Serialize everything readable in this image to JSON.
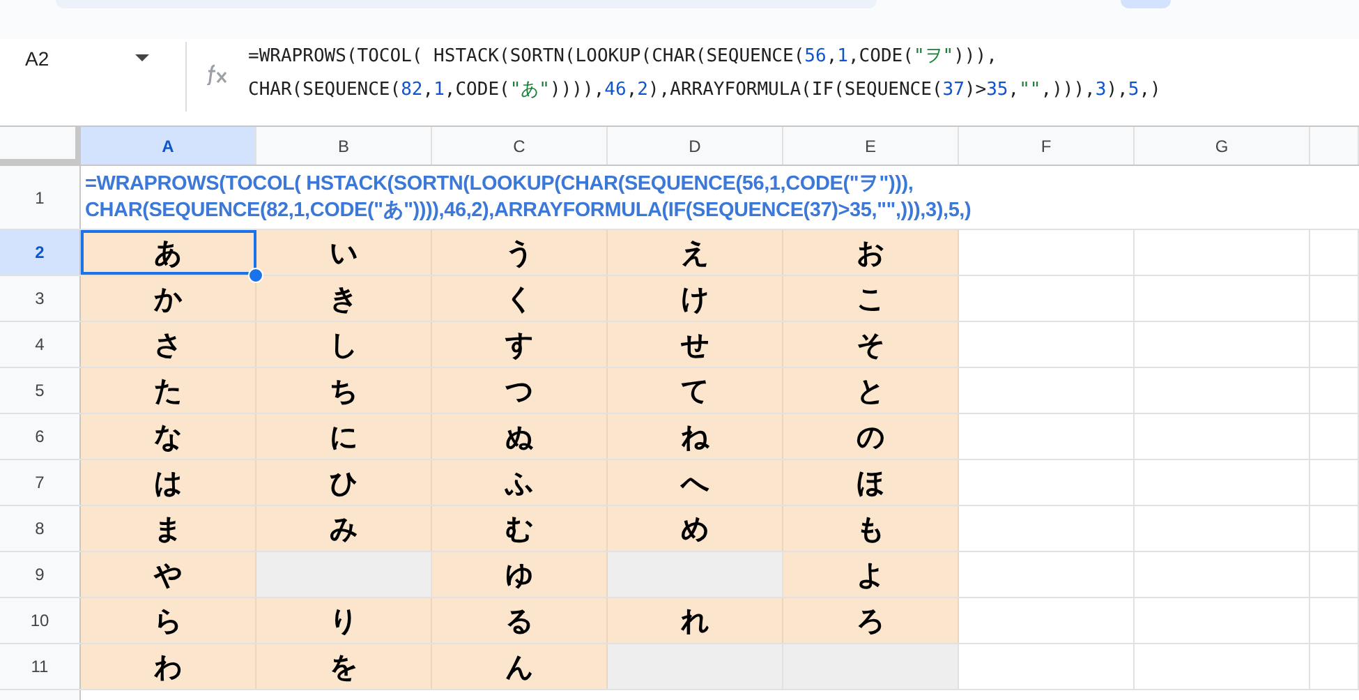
{
  "name_box": {
    "value": "A2"
  },
  "formula_bar": {
    "lines": [
      [
        {
          "kind": "text",
          "text": "=WRAPROWS(TOCOL( HSTACK(SORTN(LOOKUP(CHAR(SEQUENCE("
        },
        {
          "kind": "number",
          "text": "56"
        },
        {
          "kind": "text",
          "text": ","
        },
        {
          "kind": "number",
          "text": "1"
        },
        {
          "kind": "text",
          "text": ",CODE("
        },
        {
          "kind": "string",
          "text": "\"ヲ\""
        },
        {
          "kind": "text",
          "text": "))),"
        }
      ],
      [
        {
          "kind": "text",
          "text": "CHAR(SEQUENCE("
        },
        {
          "kind": "number",
          "text": "82"
        },
        {
          "kind": "text",
          "text": ","
        },
        {
          "kind": "number",
          "text": "1"
        },
        {
          "kind": "text",
          "text": ",CODE("
        },
        {
          "kind": "string",
          "text": "\"あ\""
        },
        {
          "kind": "text",
          "text": ")))),"
        },
        {
          "kind": "number",
          "text": "46"
        },
        {
          "kind": "text",
          "text": ","
        },
        {
          "kind": "number",
          "text": "2"
        },
        {
          "kind": "text",
          "text": "),ARRAYFORMULA(IF(SEQUENCE("
        },
        {
          "kind": "number",
          "text": "37"
        },
        {
          "kind": "text",
          "text": ")>"
        },
        {
          "kind": "number",
          "text": "35"
        },
        {
          "kind": "text",
          "text": ","
        },
        {
          "kind": "string",
          "text": "\"\""
        },
        {
          "kind": "text",
          "text": ",))),"
        },
        {
          "kind": "number",
          "text": "3"
        },
        {
          "kind": "text",
          "text": "),"
        },
        {
          "kind": "number",
          "text": "5"
        },
        {
          "kind": "text",
          "text": ",)"
        }
      ]
    ]
  },
  "columns": [
    {
      "label": "A",
      "selected": true
    },
    {
      "label": "B",
      "selected": false
    },
    {
      "label": "C",
      "selected": false
    },
    {
      "label": "D",
      "selected": false
    },
    {
      "label": "E",
      "selected": false
    },
    {
      "label": "F",
      "selected": false
    },
    {
      "label": "G",
      "selected": false
    }
  ],
  "formula_row": {
    "number": "1",
    "lines": [
      "=WRAPROWS(TOCOL( HSTACK(SORTN(LOOKUP(CHAR(SEQUENCE(56,1,CODE(\"ヲ\"))),",
      "CHAR(SEQUENCE(82,1,CODE(\"あ\")))),46,2),ARRAYFORMULA(IF(SEQUENCE(37)>35,\"\",))),3),5,)"
    ]
  },
  "rows": [
    {
      "number": "2",
      "selected": true,
      "cells": [
        {
          "kind": "kana",
          "text": "あ",
          "selected": true
        },
        {
          "kind": "kana",
          "text": "い",
          "selected": false
        },
        {
          "kind": "kana",
          "text": "う",
          "selected": false
        },
        {
          "kind": "kana",
          "text": "え",
          "selected": false
        },
        {
          "kind": "kana",
          "text": "お",
          "selected": false
        }
      ]
    },
    {
      "number": "3",
      "selected": false,
      "cells": [
        {
          "kind": "kana",
          "text": "か",
          "selected": false
        },
        {
          "kind": "kana",
          "text": "き",
          "selected": false
        },
        {
          "kind": "kana",
          "text": "く",
          "selected": false
        },
        {
          "kind": "kana",
          "text": "け",
          "selected": false
        },
        {
          "kind": "kana",
          "text": "こ",
          "selected": false
        }
      ]
    },
    {
      "number": "4",
      "selected": false,
      "cells": [
        {
          "kind": "kana",
          "text": "さ",
          "selected": false
        },
        {
          "kind": "kana",
          "text": "し",
          "selected": false
        },
        {
          "kind": "kana",
          "text": "す",
          "selected": false
        },
        {
          "kind": "kana",
          "text": "せ",
          "selected": false
        },
        {
          "kind": "kana",
          "text": "そ",
          "selected": false
        }
      ]
    },
    {
      "number": "5",
      "selected": false,
      "cells": [
        {
          "kind": "kana",
          "text": "た",
          "selected": false
        },
        {
          "kind": "kana",
          "text": "ち",
          "selected": false
        },
        {
          "kind": "kana",
          "text": "つ",
          "selected": false
        },
        {
          "kind": "kana",
          "text": "て",
          "selected": false
        },
        {
          "kind": "kana",
          "text": "と",
          "selected": false
        }
      ]
    },
    {
      "number": "6",
      "selected": false,
      "cells": [
        {
          "kind": "kana",
          "text": "な",
          "selected": false
        },
        {
          "kind": "kana",
          "text": "に",
          "selected": false
        },
        {
          "kind": "kana",
          "text": "ぬ",
          "selected": false
        },
        {
          "kind": "kana",
          "text": "ね",
          "selected": false
        },
        {
          "kind": "kana",
          "text": "の",
          "selected": false
        }
      ]
    },
    {
      "number": "7",
      "selected": false,
      "cells": [
        {
          "kind": "kana",
          "text": "は",
          "selected": false
        },
        {
          "kind": "kana",
          "text": "ひ",
          "selected": false
        },
        {
          "kind": "kana",
          "text": "ふ",
          "selected": false
        },
        {
          "kind": "kana",
          "text": "へ",
          "selected": false
        },
        {
          "kind": "kana",
          "text": "ほ",
          "selected": false
        }
      ]
    },
    {
      "number": "8",
      "selected": false,
      "cells": [
        {
          "kind": "kana",
          "text": "ま",
          "selected": false
        },
        {
          "kind": "kana",
          "text": "み",
          "selected": false
        },
        {
          "kind": "kana",
          "text": "む",
          "selected": false
        },
        {
          "kind": "kana",
          "text": "め",
          "selected": false
        },
        {
          "kind": "kana",
          "text": "も",
          "selected": false
        }
      ]
    },
    {
      "number": "9",
      "selected": false,
      "cells": [
        {
          "kind": "kana",
          "text": "や",
          "selected": false
        },
        {
          "kind": "empty",
          "selected": false
        },
        {
          "kind": "kana",
          "text": "ゆ",
          "selected": false
        },
        {
          "kind": "empty",
          "selected": false
        },
        {
          "kind": "kana",
          "text": "よ",
          "selected": false
        }
      ]
    },
    {
      "number": "10",
      "selected": false,
      "cells": [
        {
          "kind": "kana",
          "text": "ら",
          "selected": false
        },
        {
          "kind": "kana",
          "text": "り",
          "selected": false
        },
        {
          "kind": "kana",
          "text": "る",
          "selected": false
        },
        {
          "kind": "kana",
          "text": "れ",
          "selected": false
        },
        {
          "kind": "kana",
          "text": "ろ",
          "selected": false
        }
      ]
    },
    {
      "number": "11",
      "selected": false,
      "cells": [
        {
          "kind": "kana",
          "text": "わ",
          "selected": false
        },
        {
          "kind": "kana",
          "text": "を",
          "selected": false
        },
        {
          "kind": "kana",
          "text": "ん",
          "selected": false
        },
        {
          "kind": "empty",
          "selected": false
        },
        {
          "kind": "empty",
          "selected": false
        }
      ]
    }
  ]
}
